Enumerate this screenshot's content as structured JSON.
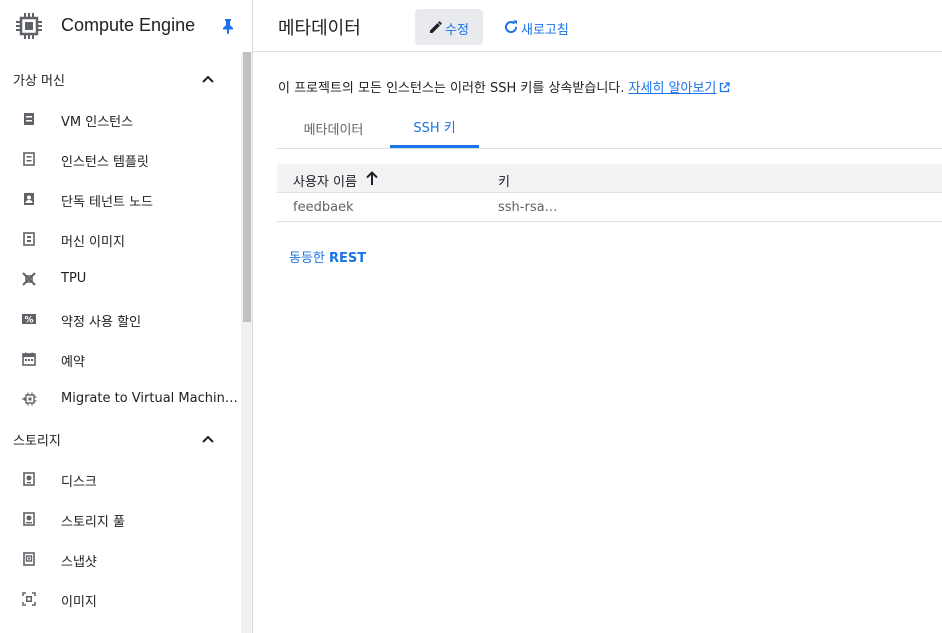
{
  "sidebar": {
    "app_title": "Compute Engine",
    "sections": [
      {
        "label": "가상 머신",
        "items": [
          {
            "label": "VM 인스턴스",
            "icon": "vm-instance-icon"
          },
          {
            "label": "인스턴스 템플릿",
            "icon": "instance-template-icon"
          },
          {
            "label": "단독 테넌트 노드",
            "icon": "sole-tenant-icon"
          },
          {
            "label": "머신 이미지",
            "icon": "machine-image-icon"
          },
          {
            "label": "TPU",
            "icon": "tpu-icon"
          },
          {
            "label": "약정 사용 할인",
            "icon": "discount-icon"
          },
          {
            "label": "예약",
            "icon": "calendar-icon"
          },
          {
            "label": "Migrate to Virtual Machin…",
            "icon": "migrate-icon"
          }
        ]
      },
      {
        "label": "스토리지",
        "items": [
          {
            "label": "디스크",
            "icon": "disk-icon"
          },
          {
            "label": "스토리지 풀",
            "icon": "storage-pool-icon"
          },
          {
            "label": "스냅샷",
            "icon": "snapshot-icon"
          },
          {
            "label": "이미지",
            "icon": "image-icon"
          }
        ]
      }
    ]
  },
  "topbar": {
    "title": "메타데이터",
    "edit_label": "수정",
    "refresh_label": "새로고침"
  },
  "description": {
    "text": "이 프로젝트의 모든 인스턴스는 이러한 SSH 키를 상속받습니다.",
    "link": "자세히 알아보기"
  },
  "tabs": [
    {
      "label": "메타데이터",
      "active": false
    },
    {
      "label": "SSH 키",
      "active": true
    }
  ],
  "table": {
    "columns": [
      "사용자 이름",
      "키"
    ],
    "rows": [
      [
        "feedbaek",
        "ssh-rsa…"
      ]
    ]
  },
  "rest": {
    "prefix": "동등한",
    "label": "REST"
  },
  "colors": {
    "accent": "#1a73e8",
    "text": "#202124",
    "muted": "#5f6368"
  }
}
